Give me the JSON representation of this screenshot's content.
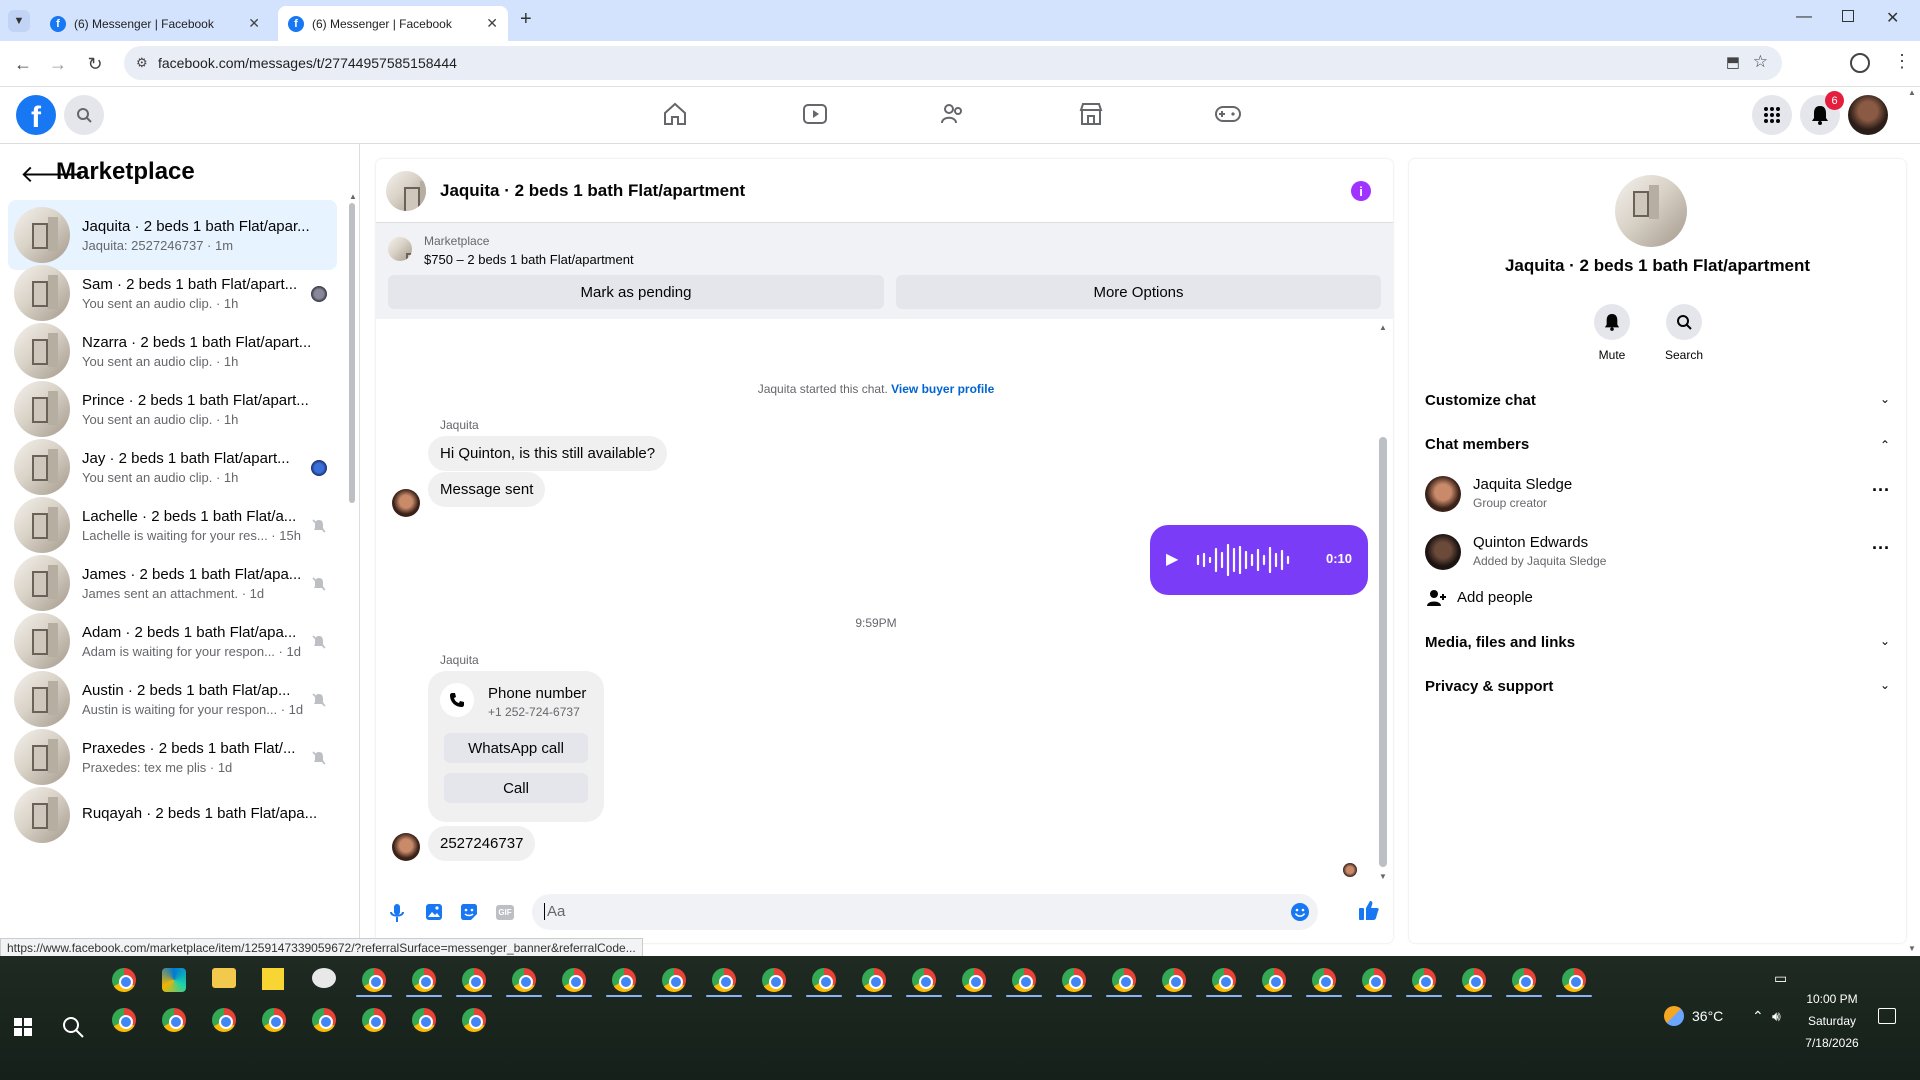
{
  "browser": {
    "tabs": [
      {
        "title": "(6) Messenger | Facebook"
      },
      {
        "title": "(6) Messenger | Facebook"
      }
    ],
    "url": "facebook.com/messages/t/27744957585158444",
    "status_url": "https://www.facebook.com/marketplace/item/1259147339059672/?referralSurface=messenger_banner&referralCode..."
  },
  "fb_header": {
    "notification_count": "6"
  },
  "left": {
    "title": "Marketplace",
    "conversations": [
      {
        "name": "Jaquita · 2 beds 1 bath Flat/apar...",
        "sub": "Jaquita: 2527246737 · 1m"
      },
      {
        "name": "Sam · 2 beds 1 bath Flat/apart...",
        "sub": "You sent an audio clip. · 1h"
      },
      {
        "name": "Nzarra · 2 beds 1 bath Flat/apart...",
        "sub": "You sent an audio clip. · 1h"
      },
      {
        "name": "Prince · 2 beds 1 bath Flat/apart...",
        "sub": "You sent an audio clip. · 1h"
      },
      {
        "name": "Jay · 2 beds 1 bath Flat/apart...",
        "sub": "You sent an audio clip. · 1h"
      },
      {
        "name": "Lachelle · 2 beds 1 bath Flat/a...",
        "sub": "Lachelle is waiting for your res... · 15h"
      },
      {
        "name": "James · 2 beds 1 bath Flat/apa...",
        "sub": "James sent an attachment. · 1d"
      },
      {
        "name": "Adam · 2 beds 1 bath Flat/apa...",
        "sub": "Adam is waiting for your respon... · 1d"
      },
      {
        "name": "Austin · 2 beds 1 bath Flat/ap...",
        "sub": "Austin is waiting for your respon... · 1d"
      },
      {
        "name": "Praxedes · 2 beds 1 bath Flat/...",
        "sub": "Praxedes: tex me plis · 1d"
      },
      {
        "name": "Ruqayah · 2 beds 1 bath Flat/apa...",
        "sub": ""
      }
    ]
  },
  "chat": {
    "title": "Jaquita · 2 beds 1 bath Flat/apartment",
    "listing_label": "Marketplace",
    "listing_title": "$750 – 2 beds 1 bath Flat/apartment",
    "mark_pending": "Mark as pending",
    "more_options": "More Options",
    "started_text": "Jaquita started this chat.",
    "buyer_profile": "View buyer profile",
    "sender": "Jaquita",
    "msg1": "Hi Quinton, is this still available?",
    "msg2": "Message sent",
    "audio_duration": "0:10",
    "timestamp": "9:59PM",
    "sender2": "Jaquita",
    "phone_title": "Phone number",
    "phone_number": "+1 252-724-6737",
    "whatsapp": "WhatsApp call",
    "call": "Call",
    "msg3": "2527246737",
    "composer_placeholder": "Aa"
  },
  "right": {
    "title": "Jaquita · 2 beds 1 bath Flat/apartment",
    "mute": "Mute",
    "search": "Search",
    "customize": "Customize chat",
    "members": "Chat members",
    "member1_name": "Jaquita Sledge",
    "member1_sub": "Group creator",
    "member2_name": "Quinton Edwards",
    "member2_sub": "Added by Jaquita Sledge",
    "add_people": "Add people",
    "media": "Media, files and links",
    "privacy": "Privacy & support"
  },
  "taskbar": {
    "temp": "36°C",
    "time": "10:00 PM",
    "day": "Saturday",
    "date": "7/18/2026"
  },
  "colors": {
    "accent": "#1877f2",
    "audio": "#7b3cf7",
    "info": "#a033ff"
  }
}
